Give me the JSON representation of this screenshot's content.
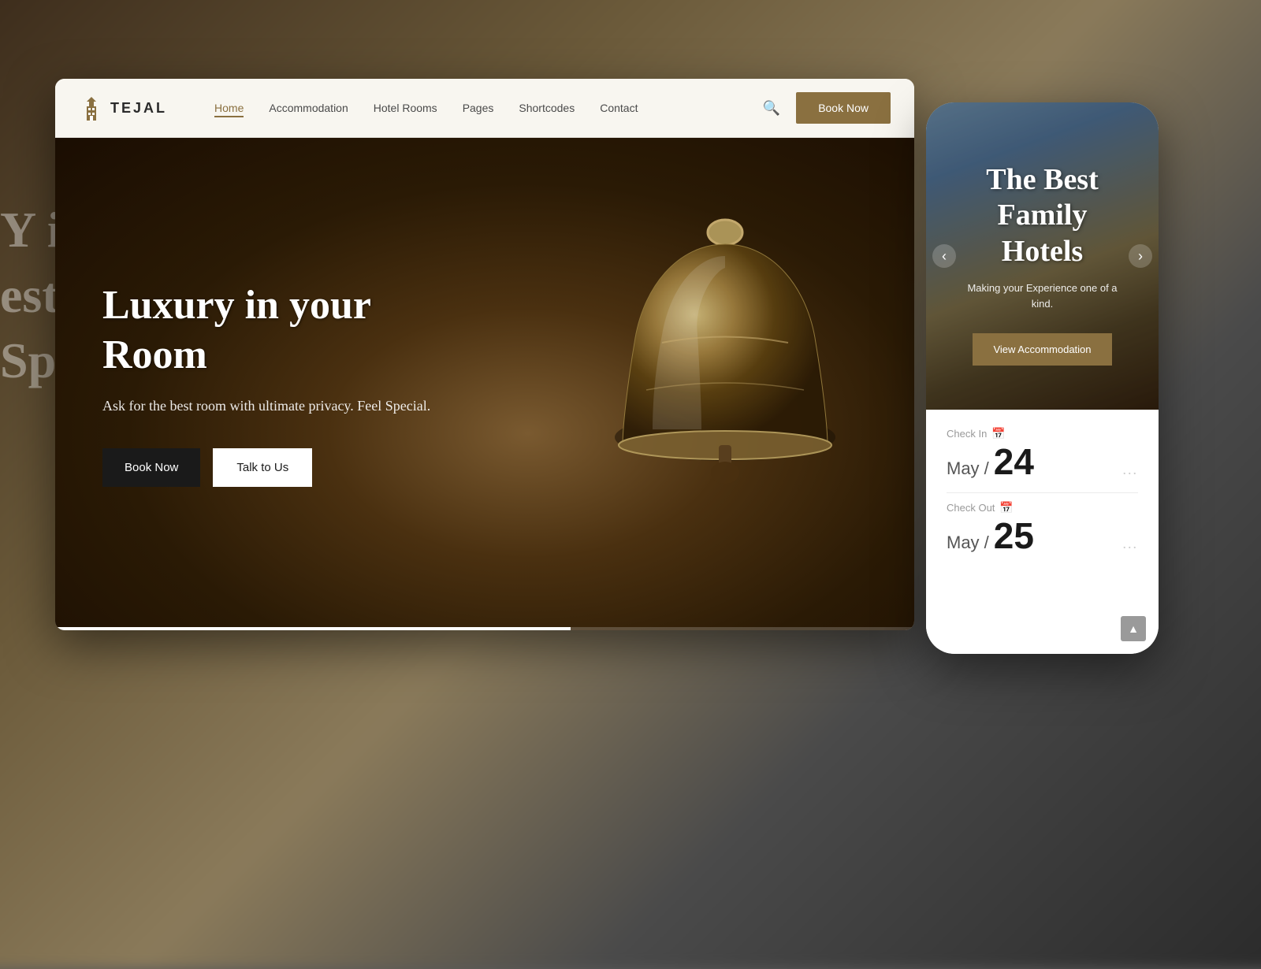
{
  "background": {
    "gradient": "dark brown blurred"
  },
  "side_text": {
    "line1": "Y i",
    "line2": "est",
    "line3": "Spe"
  },
  "browser": {
    "navbar": {
      "logo": {
        "icon": "building-icon",
        "text": "TEJAL"
      },
      "nav_links": [
        {
          "label": "Home",
          "active": true
        },
        {
          "label": "Accommodation",
          "active": false
        },
        {
          "label": "Hotel Rooms",
          "active": false
        },
        {
          "label": "Pages",
          "active": false
        },
        {
          "label": "Shortcodes",
          "active": false
        },
        {
          "label": "Contact",
          "active": false
        }
      ],
      "book_now_label": "Book Now"
    },
    "hero": {
      "title": "Luxury in your Room",
      "subtitle": "Ask for the best room with ultimate privacy. Feel Special.",
      "btn_book": "Book Now",
      "btn_talk": "Talk to Us"
    }
  },
  "phone": {
    "hero": {
      "title": "The Best Family Hotels",
      "subtitle": "Making your Experience one of a kind.",
      "view_btn_label": "View Accommodation",
      "prev_label": "‹",
      "next_label": "›"
    },
    "booking": {
      "checkin": {
        "label": "Check In",
        "month": "May /",
        "day": "24",
        "dots": "..."
      },
      "checkout": {
        "label": "Check Out",
        "month": "May /",
        "day": "25",
        "dots": "..."
      }
    },
    "scroll_up": "▲"
  },
  "colors": {
    "gold": "#8a7040",
    "dark": "#1a1a1a",
    "white": "#ffffff"
  }
}
